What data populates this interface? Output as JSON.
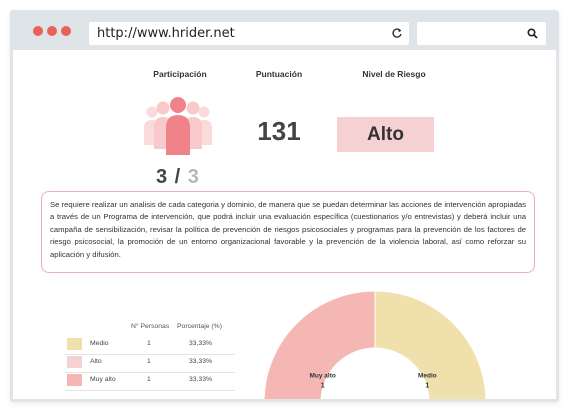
{
  "browser": {
    "url": "http://www.hrider.net"
  },
  "summary": {
    "headers": {
      "participation": "Participación",
      "score": "Puntuación",
      "risk_level": "Nivel de Riesgo"
    },
    "participation_done": "3",
    "participation_sep": " / ",
    "participation_total": "3",
    "score_value": "131",
    "risk_value": "Alto"
  },
  "notice": "Se requiere realizar un analisis de cada categoria y dominio, de manera que se puedan determinar las acciones de intervención apropiadas a través de un Programa de intervención, que podrá incluir una evaluación específica (cuestionarios y/o entrevistas) y deberá incluir una campaña de sensibilización, revisar la política de prevención de riesgos psicosociales y programas para la prevención de los factores de riesgo psicosocial, la promoción de un entorno organizacional favorable y la prevención de la violencia laboral, así como reforzar su aplicación y difusión.",
  "distribution": {
    "headers": {
      "count": "N° Personas",
      "percent": "Porcentaje (%)"
    },
    "rows": [
      {
        "label": "Medio",
        "count": "1",
        "percent": "33,33%",
        "color": "#efe0ac"
      },
      {
        "label": "Alto",
        "count": "1",
        "percent": "33,33%",
        "color": "#f6d1d2"
      },
      {
        "label": "Muy alto",
        "count": "1",
        "percent": "33,33%",
        "color": "#f4b7b4"
      }
    ]
  },
  "chart_data": {
    "type": "pie",
    "categories": [
      "Muy alto",
      "Medio"
    ],
    "values": [
      1,
      1
    ],
    "colors": [
      "#f4b7b4",
      "#efe0ac"
    ],
    "data_labels": [
      "1",
      "1"
    ]
  },
  "colors": {
    "accent": "#e9625a",
    "risk_high": "#f6d1d2",
    "person_icon": "#f0828a",
    "person_icon_light": "#f9c8ca"
  }
}
